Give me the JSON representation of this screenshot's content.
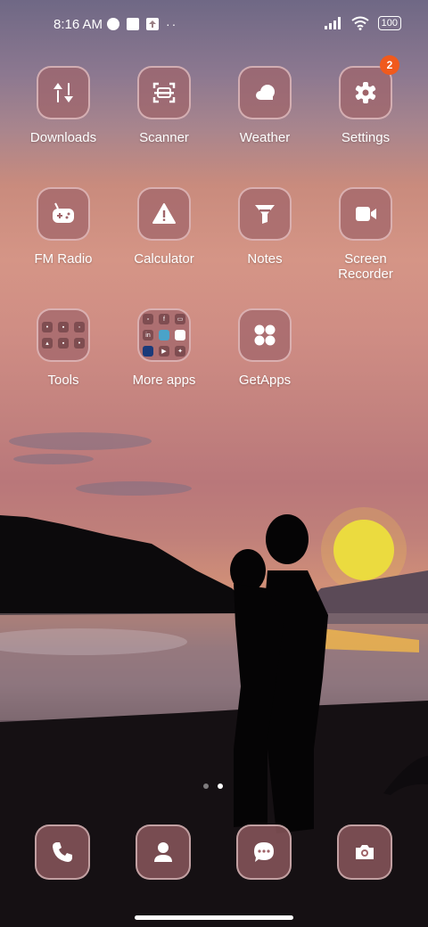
{
  "status_bar": {
    "time": "8:16 AM",
    "battery": "100",
    "icons": [
      "media-icon",
      "notification-square-icon",
      "upload-icon",
      "more-dots-icon",
      "signal-icon",
      "wifi-icon",
      "battery-icon"
    ]
  },
  "apps": [
    {
      "label": "Downloads",
      "icon": "downloads-icon"
    },
    {
      "label": "Scanner",
      "icon": "scanner-icon"
    },
    {
      "label": "Weather",
      "icon": "weather-icon"
    },
    {
      "label": "Settings",
      "icon": "gear-icon",
      "badge": "2"
    },
    {
      "label": "FM Radio",
      "icon": "radio-icon"
    },
    {
      "label": "Calculator",
      "icon": "warning-icon"
    },
    {
      "label": "Notes",
      "icon": "funnel-icon"
    },
    {
      "label": "Screen\nRecorder",
      "icon": "video-icon"
    },
    {
      "label": "Tools",
      "icon": "folder-icon"
    },
    {
      "label": "More apps",
      "icon": "folder-icon"
    },
    {
      "label": "GetApps",
      "icon": "apps-grid-icon"
    }
  ],
  "dock": [
    {
      "name": "phone",
      "icon": "phone-icon"
    },
    {
      "name": "contacts",
      "icon": "contact-icon"
    },
    {
      "name": "messages",
      "icon": "message-icon"
    },
    {
      "name": "camera",
      "icon": "camera-icon"
    }
  ],
  "pages": {
    "count": 2,
    "active": 2
  },
  "colors": {
    "tile": "#a06469",
    "badge": "#f05a1d"
  }
}
